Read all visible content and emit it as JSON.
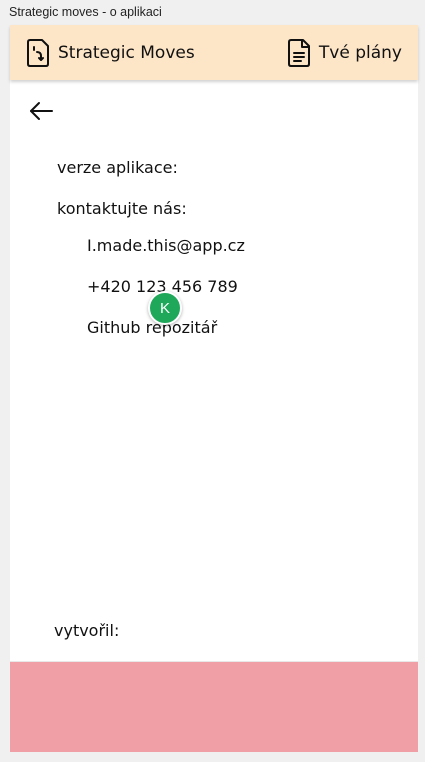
{
  "window": {
    "title": "Strategic moves - o aplikaci"
  },
  "nav": {
    "left_label": "Strategic Moves",
    "left_icon": "moves-document-icon",
    "right_label": "Tvé plány",
    "right_icon": "plans-document-icon",
    "bar_color": "#fde5c8"
  },
  "about": {
    "version_label": "verze aplikace:",
    "contact_label": "kontaktujte nás:",
    "email": "I.made.this@app.cz",
    "phone": "+420 123 456 789",
    "github": "Github repozitář",
    "author_label": "vytvořil:"
  },
  "avatar": {
    "initial": "K",
    "color": "#1fa85a"
  },
  "bottom_panel": {
    "color": "#f09fa6"
  }
}
